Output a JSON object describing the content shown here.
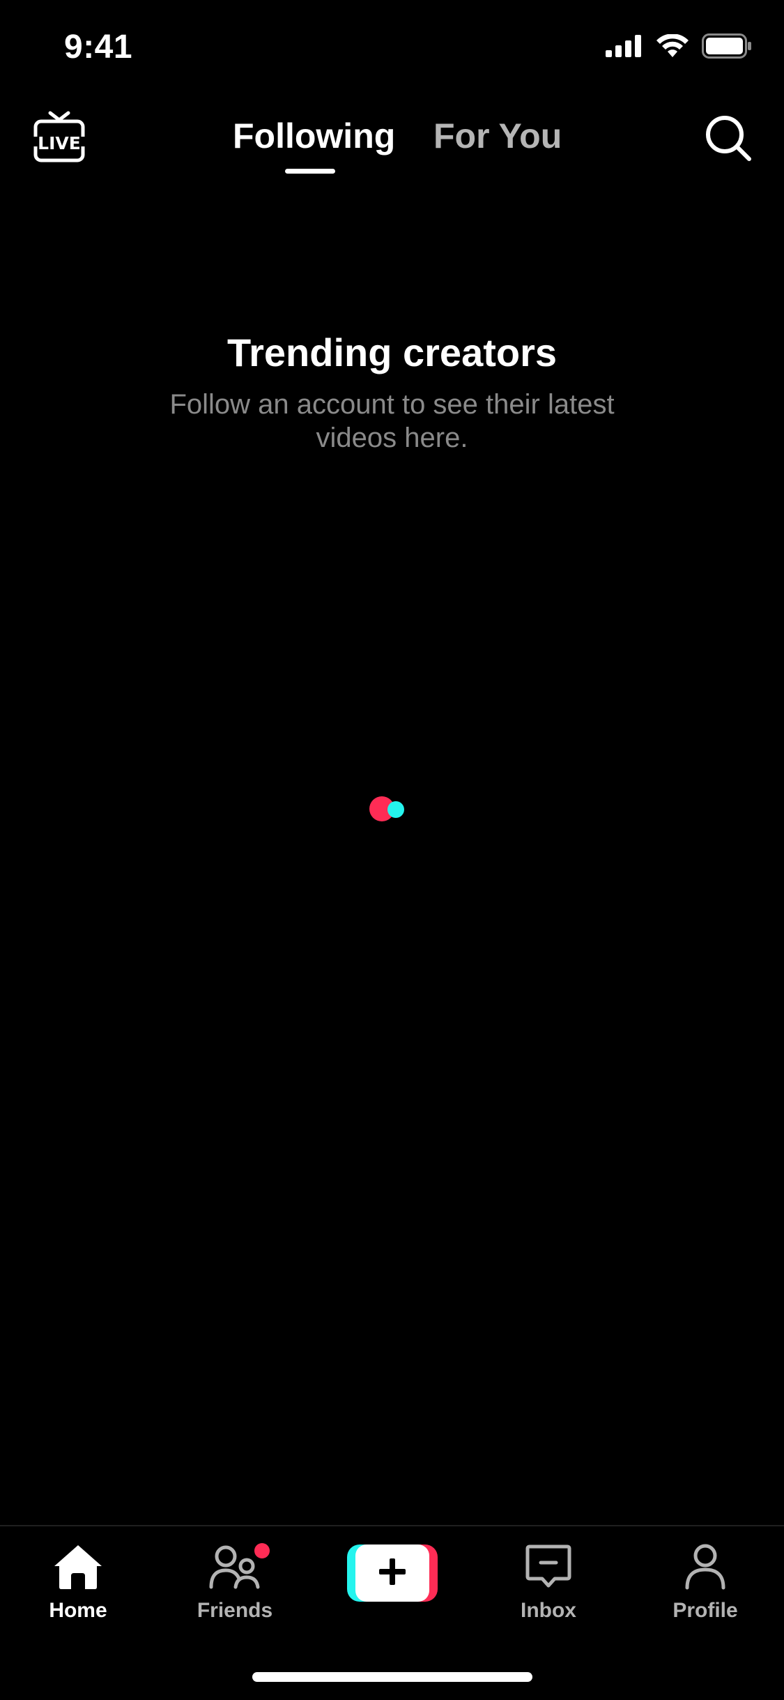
{
  "status_bar": {
    "time": "9:41"
  },
  "top_nav": {
    "live_icon_text": "LIVE",
    "tabs": [
      {
        "label": "Following",
        "active": true
      },
      {
        "label": "For You",
        "active": false
      }
    ]
  },
  "empty_state": {
    "title": "Trending creators",
    "subtitle": "Follow an account to see their latest videos here."
  },
  "bottom_nav": {
    "items": [
      {
        "label": "Home",
        "icon": "home-icon",
        "active": true
      },
      {
        "label": "Friends",
        "icon": "friends-icon",
        "active": false,
        "has_notification": true
      },
      {
        "label": "",
        "icon": "plus-icon",
        "active": false
      },
      {
        "label": "Inbox",
        "icon": "inbox-icon",
        "active": false
      },
      {
        "label": "Profile",
        "icon": "profile-icon",
        "active": false
      }
    ]
  },
  "colors": {
    "background": "#000000",
    "accent_red": "#fe2c55",
    "accent_cyan": "#25f4ee",
    "inactive_text": "#b3b3b3",
    "subtitle_text": "#8a8a8a"
  }
}
